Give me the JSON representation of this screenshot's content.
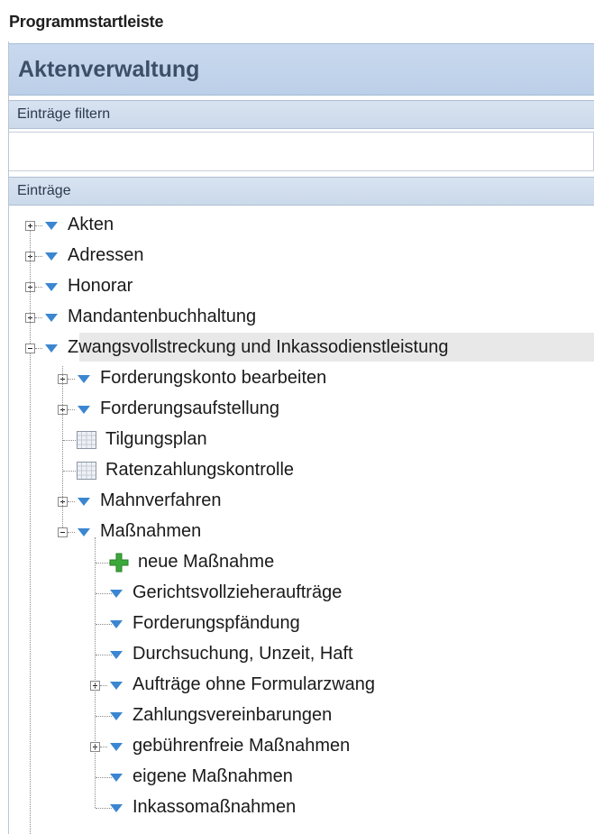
{
  "window": {
    "title": "Programmstartleiste"
  },
  "section": {
    "title": "Aktenverwaltung"
  },
  "filter": {
    "header": "Einträge filtern",
    "value": "",
    "placeholder": ""
  },
  "entries": {
    "header": "Einträge",
    "items": [
      {
        "label": "Akten",
        "icon": "triangle-down-icon",
        "expander": "plus"
      },
      {
        "label": "Adressen",
        "icon": "triangle-down-icon",
        "expander": "plus"
      },
      {
        "label": "Honorar",
        "icon": "triangle-down-icon",
        "expander": "plus"
      },
      {
        "label": "Mandantenbuchhaltung",
        "icon": "triangle-down-icon",
        "expander": "plus"
      },
      {
        "label": "Zwangsvollstreckung und Inkassodienstleistung",
        "icon": "triangle-down-icon",
        "expander": "minus",
        "selected": true
      },
      {
        "label": "Forderungskonto bearbeiten",
        "icon": "triangle-down-icon",
        "expander": "plus"
      },
      {
        "label": "Forderungsaufstellung",
        "icon": "triangle-down-icon",
        "expander": "plus"
      },
      {
        "label": "Tilgungsplan",
        "icon": "calendar-grid-icon",
        "expander": "none"
      },
      {
        "label": "Ratenzahlungskontrolle",
        "icon": "calendar-grid-icon",
        "expander": "none"
      },
      {
        "label": "Mahnverfahren",
        "icon": "triangle-down-icon",
        "expander": "plus"
      },
      {
        "label": "Maßnahmen",
        "icon": "triangle-down-icon",
        "expander": "minus"
      },
      {
        "label": "neue Maßnahme",
        "icon": "green-plus-icon",
        "expander": "none"
      },
      {
        "label": "Gerichtsvollzieheraufträge",
        "icon": "triangle-down-icon",
        "expander": "none"
      },
      {
        "label": "Forderungspfändung",
        "icon": "triangle-down-icon",
        "expander": "none"
      },
      {
        "label": "Durchsuchung, Unzeit, Haft",
        "icon": "triangle-down-icon",
        "expander": "none"
      },
      {
        "label": "Aufträge ohne Formularzwang",
        "icon": "triangle-down-icon",
        "expander": "plus"
      },
      {
        "label": "Zahlungsvereinbarungen",
        "icon": "triangle-down-icon",
        "expander": "none"
      },
      {
        "label": "gebührenfreie Maßnahmen",
        "icon": "triangle-down-icon",
        "expander": "plus"
      },
      {
        "label": "eigene Maßnahmen",
        "icon": "triangle-down-icon",
        "expander": "none"
      },
      {
        "label": "Inkassomaßnahmen",
        "icon": "triangle-down-icon",
        "expander": "none"
      }
    ]
  },
  "colors": {
    "header_bg": "#c9d9ee",
    "triangle": "#3b86d1",
    "plus_green": "#3aa93a",
    "selection": "#e8e8e8"
  }
}
